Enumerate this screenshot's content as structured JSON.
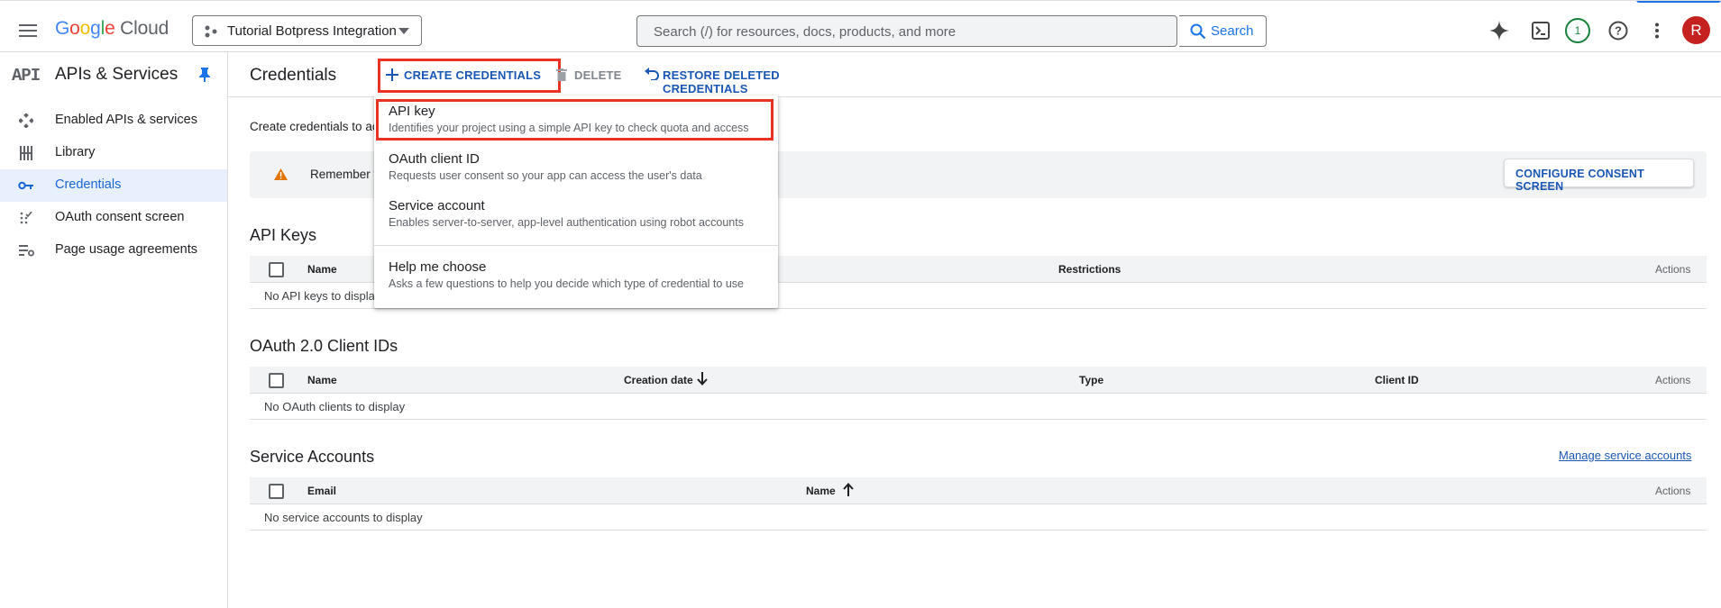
{
  "topbar": {
    "logo_text": "Google Cloud",
    "project": "Tutorial Botpress Integration",
    "search_placeholder": "Search (/) for resources, docs, products, and more",
    "search_button": "Search",
    "notifications_count": "1",
    "avatar_letter": "R"
  },
  "sidebar": {
    "logo": "API",
    "title": "APIs & Services",
    "items": [
      {
        "label": "Enabled APIs & services",
        "icon": "enabled-apis-icon"
      },
      {
        "label": "Library",
        "icon": "library-icon"
      },
      {
        "label": "Credentials",
        "icon": "key-icon",
        "active": true
      },
      {
        "label": "OAuth consent screen",
        "icon": "consent-icon"
      },
      {
        "label": "Page usage agreements",
        "icon": "settings-list-icon"
      }
    ]
  },
  "header": {
    "title": "Credentials",
    "create_button": "CREATE CREDENTIALS",
    "delete_button": "DELETE",
    "restore_button": "RESTORE DELETED CREDENTIALS"
  },
  "main": {
    "intro_text": "Create credentials to ac",
    "banner_text": "Remember t",
    "consent_button": "CONFIGURE CONSENT SCREEN",
    "api_keys": {
      "title": "API Keys",
      "columns": [
        "Name",
        "Restrictions",
        "Actions"
      ],
      "empty": "No API keys to displa"
    },
    "oauth": {
      "title": "OAuth 2.0 Client IDs",
      "columns": [
        "Name",
        "Creation date",
        "Type",
        "Client ID",
        "Actions"
      ],
      "empty": "No OAuth clients to display"
    },
    "service_accounts": {
      "title": "Service Accounts",
      "manage_link": "Manage service accounts",
      "columns": [
        "Email",
        "Name",
        "Actions"
      ],
      "empty": "No service accounts to display"
    }
  },
  "menu": {
    "items": [
      {
        "title": "API key",
        "desc": "Identifies your project using a simple API key to check quota and access"
      },
      {
        "title": "OAuth client ID",
        "desc": "Requests user consent so your app can access the user's data"
      },
      {
        "title": "Service account",
        "desc": "Enables server-to-server, app-level authentication using robot accounts"
      },
      {
        "title": "Help me choose",
        "desc": "Asks a few questions to help you decide which type of credential to use"
      }
    ]
  },
  "colors": {
    "accent": "#1a73e8",
    "highlight": "#ea3323",
    "warning": "#e37400",
    "active_bg": "#e8f0fe"
  }
}
